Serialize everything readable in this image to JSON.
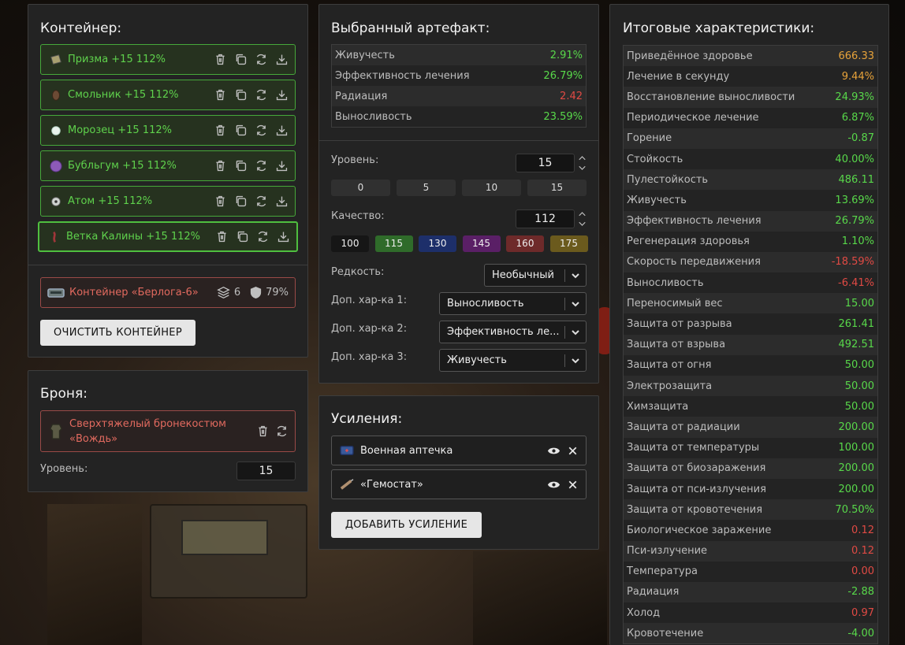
{
  "container_panel": {
    "title": "Контейнер:",
    "items": [
      {
        "name": "Призма +15 112%",
        "icon": "prism-artifact-icon"
      },
      {
        "name": "Смольник +15 112%",
        "icon": "resin-artifact-icon"
      },
      {
        "name": "Морозец +15 112%",
        "icon": "frost-artifact-icon"
      },
      {
        "name": "Бубльгум +15 112%",
        "icon": "bubblegum-artifact-icon"
      },
      {
        "name": "Атом +15 112%",
        "icon": "atom-artifact-icon"
      },
      {
        "name": "Ветка Калины +15 112%",
        "icon": "viburnum-artifact-icon"
      }
    ],
    "container": {
      "name": "Контейнер «Берлога-6»",
      "slots": "6",
      "protection": "79%"
    },
    "clear_label": "ОЧИСТИТЬ КОНТЕЙНЕР"
  },
  "armor_panel": {
    "title": "Броня:",
    "armor_name": "Сверхтяжелый бронекостюм «Вождь»",
    "level_label": "Уровень:",
    "level_value": "15"
  },
  "artifact_panel": {
    "title": "Выбранный артефакт:",
    "stats": [
      {
        "label": "Живучесть",
        "value": "2.91%",
        "color": "green"
      },
      {
        "label": "Эффективность лечения",
        "value": "26.79%",
        "color": "green"
      },
      {
        "label": "Радиация",
        "value": "2.42",
        "color": "red"
      },
      {
        "label": "Выносливость",
        "value": "23.59%",
        "color": "green"
      }
    ],
    "level_label": "Уровень:",
    "level_value": "15",
    "level_presets": [
      "0",
      "5",
      "10",
      "15"
    ],
    "quality_label": "Качество:",
    "quality_value": "112",
    "quality_presets": [
      {
        "label": "100",
        "color": "#161616"
      },
      {
        "label": "115",
        "color": "#2f6b2a"
      },
      {
        "label": "130",
        "color": "#1d2f6a"
      },
      {
        "label": "145",
        "color": "#5a1f66"
      },
      {
        "label": "160",
        "color": "#6e2a2a"
      },
      {
        "label": "175",
        "color": "#6b5a1d"
      }
    ],
    "rarity_label": "Редкость:",
    "rarity_value": "Необычный",
    "extra1_label": "Доп. хар-ка 1:",
    "extra1_value": "Выносливость",
    "extra2_label": "Доп. хар-ка 2:",
    "extra2_value": "Эффективность ле...",
    "extra3_label": "Доп. хар-ка 3:",
    "extra3_value": "Живучесть"
  },
  "boosts_panel": {
    "title": "Усиления:",
    "items": [
      {
        "name": "Военная аптечка",
        "icon": "military-medkit-icon"
      },
      {
        "name": "«Гемостат»",
        "icon": "hemostat-syringe-icon"
      }
    ],
    "add_label": "ДОБАВИТЬ УСИЛЕНИЕ"
  },
  "totals_panel": {
    "title": "Итоговые характеристики:",
    "stats": [
      {
        "label": "Приведённое здоровье",
        "value": "666.33",
        "color": "orange"
      },
      {
        "label": "Лечение в секунду",
        "value": "9.44%",
        "color": "orange"
      },
      {
        "label": "Восстановление выносливости",
        "value": "24.93%",
        "color": "green"
      },
      {
        "label": "Периодическое лечение",
        "value": "6.87%",
        "color": "green"
      },
      {
        "label": "Горение",
        "value": "-0.87",
        "color": "green"
      },
      {
        "label": "Стойкость",
        "value": "40.00%",
        "color": "green"
      },
      {
        "label": "Пулестойкость",
        "value": "486.11",
        "color": "green"
      },
      {
        "label": "Живучесть",
        "value": "13.69%",
        "color": "green"
      },
      {
        "label": "Эффективность лечения",
        "value": "26.79%",
        "color": "green"
      },
      {
        "label": "Регенерация здоровья",
        "value": "1.10%",
        "color": "green"
      },
      {
        "label": "Скорость передвижения",
        "value": "-18.59%",
        "color": "red"
      },
      {
        "label": "Выносливость",
        "value": "-6.41%",
        "color": "red"
      },
      {
        "label": "Переносимый вес",
        "value": "15.00",
        "color": "green"
      },
      {
        "label": "Защита от разрыва",
        "value": "261.41",
        "color": "green"
      },
      {
        "label": "Защита от взрыва",
        "value": "492.51",
        "color": "green"
      },
      {
        "label": "Защита от огня",
        "value": "50.00",
        "color": "green"
      },
      {
        "label": "Электрозащита",
        "value": "50.00",
        "color": "green"
      },
      {
        "label": "Химзащита",
        "value": "50.00",
        "color": "green"
      },
      {
        "label": "Защита от радиации",
        "value": "200.00",
        "color": "green"
      },
      {
        "label": "Защита от температуры",
        "value": "100.00",
        "color": "green"
      },
      {
        "label": "Защита от биозаражения",
        "value": "200.00",
        "color": "green"
      },
      {
        "label": "Защита от пси-излучения",
        "value": "200.00",
        "color": "green"
      },
      {
        "label": "Защита от кровотечения",
        "value": "70.50%",
        "color": "green"
      },
      {
        "label": "Биологическое заражение",
        "value": "0.12",
        "color": "red"
      },
      {
        "label": "Пси-излучение",
        "value": "0.12",
        "color": "red"
      },
      {
        "label": "Температура",
        "value": "0.00",
        "color": "red"
      },
      {
        "label": "Радиация",
        "value": "-2.88",
        "color": "green"
      },
      {
        "label": "Холод",
        "value": "0.97",
        "color": "red"
      },
      {
        "label": "Кровотечение",
        "value": "-4.00",
        "color": "green"
      }
    ]
  }
}
